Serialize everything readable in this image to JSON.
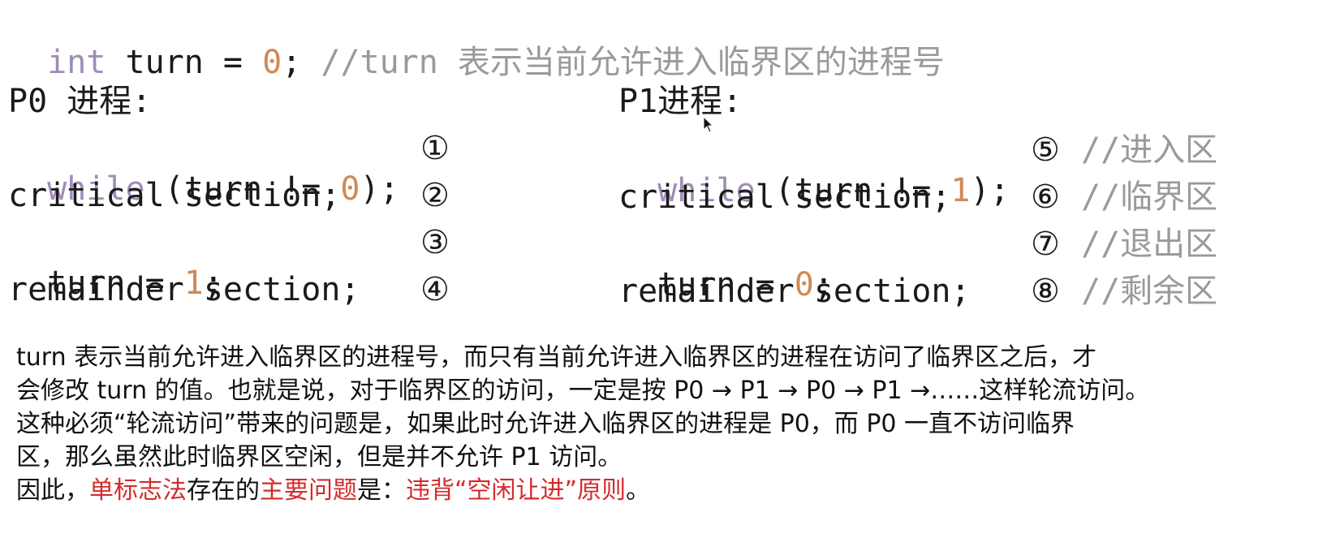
{
  "header": {
    "kw": "int",
    "var": " turn = ",
    "num": "0",
    "semi": "; ",
    "comment": "//turn 表示当前允许进入临界区的进程号"
  },
  "p0": {
    "title": "P0 进程:",
    "lines": [
      {
        "kw": "while",
        "pre": " (turn != ",
        "num": "0",
        "post": ");",
        "marker": "①"
      },
      {
        "text": "critical section;",
        "marker": "②"
      },
      {
        "pre": "turn = ",
        "num": "1",
        "post": ";",
        "marker": "③"
      },
      {
        "text": "remainder section;",
        "marker": "④"
      }
    ]
  },
  "p1": {
    "title": "P1进程:",
    "lines": [
      {
        "kw": "while",
        "pre": " (turn != ",
        "num": "1",
        "post": ");",
        "marker": "⑤",
        "comment": "//进入区"
      },
      {
        "text": "critical section;",
        "marker": "⑥",
        "comment": "//临界区"
      },
      {
        "pre": "turn = ",
        "num": "0",
        "post": ";",
        "marker": "⑦",
        "comment": "//退出区"
      },
      {
        "text": "remainder section;",
        "marker": "⑧",
        "comment": "//剩余区"
      }
    ]
  },
  "explanation": {
    "line1": "turn 表示当前允许进入临界区的进程号，而只有当前允许进入临界区的进程在访问了临界区之后，才",
    "line2": "会修改 turn 的值。也就是说，对于临界区的访问，一定是按 P0 → P1 → P0 → P1 →……这样轮流访问。",
    "line3": "这种必须“轮流访问”带来的问题是，如果此时允许进入临界区的进程是 P0，而 P0 一直不访问临界",
    "line4": "区，那么虽然此时临界区空闲，但是并不允许 P1 访问。",
    "line5_a": "因此，",
    "line5_b": "单标志法",
    "line5_c": "存在的",
    "line5_d": "主要问题",
    "line5_e": "是：",
    "line5_f": "违背“空闲让进”原则",
    "line5_g": "。"
  },
  "colors": {
    "keyword": "#a08cb8",
    "number": "#d08a55",
    "comment": "#9a9a9a",
    "highlight": "#d42b2b"
  },
  "icons": {
    "cursor": "mouse-pointer-icon"
  }
}
